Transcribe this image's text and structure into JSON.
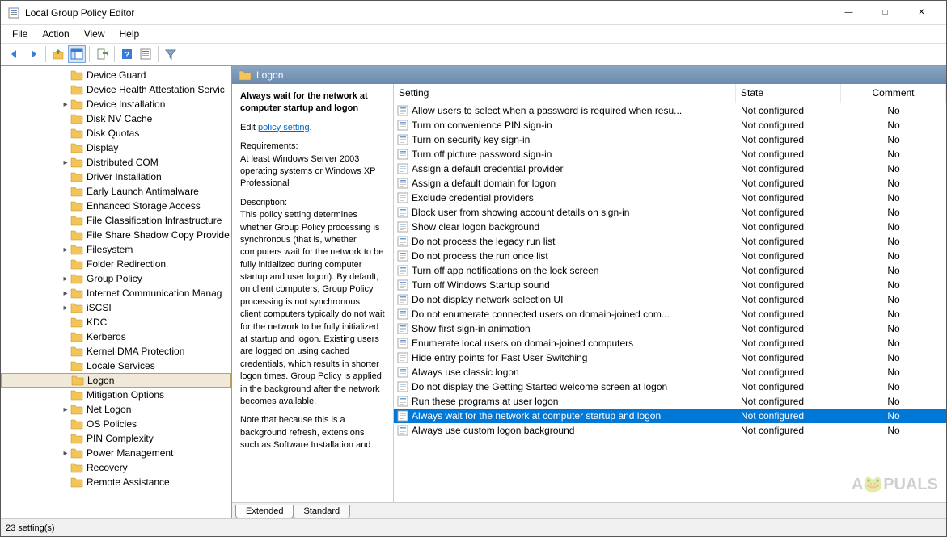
{
  "window": {
    "title": "Local Group Policy Editor"
  },
  "menu": {
    "items": [
      "File",
      "Action",
      "View",
      "Help"
    ]
  },
  "tree": {
    "items": [
      {
        "indent": 72,
        "label": "Device Guard",
        "expand": ""
      },
      {
        "indent": 72,
        "label": "Device Health Attestation Servic",
        "expand": ""
      },
      {
        "indent": 72,
        "label": "Device Installation",
        "expand": ">"
      },
      {
        "indent": 72,
        "label": "Disk NV Cache",
        "expand": ""
      },
      {
        "indent": 72,
        "label": "Disk Quotas",
        "expand": ""
      },
      {
        "indent": 72,
        "label": "Display",
        "expand": ""
      },
      {
        "indent": 72,
        "label": "Distributed COM",
        "expand": ">"
      },
      {
        "indent": 72,
        "label": "Driver Installation",
        "expand": ""
      },
      {
        "indent": 72,
        "label": "Early Launch Antimalware",
        "expand": ""
      },
      {
        "indent": 72,
        "label": "Enhanced Storage Access",
        "expand": ""
      },
      {
        "indent": 72,
        "label": "File Classification Infrastructure",
        "expand": ""
      },
      {
        "indent": 72,
        "label": "File Share Shadow Copy Provide",
        "expand": ""
      },
      {
        "indent": 72,
        "label": "Filesystem",
        "expand": ">"
      },
      {
        "indent": 72,
        "label": "Folder Redirection",
        "expand": ""
      },
      {
        "indent": 72,
        "label": "Group Policy",
        "expand": ">"
      },
      {
        "indent": 72,
        "label": "Internet Communication Manag",
        "expand": ">"
      },
      {
        "indent": 72,
        "label": "iSCSI",
        "expand": ">"
      },
      {
        "indent": 72,
        "label": "KDC",
        "expand": ""
      },
      {
        "indent": 72,
        "label": "Kerberos",
        "expand": ""
      },
      {
        "indent": 72,
        "label": "Kernel DMA Protection",
        "expand": ""
      },
      {
        "indent": 72,
        "label": "Locale Services",
        "expand": ""
      },
      {
        "indent": 72,
        "label": "Logon",
        "expand": "",
        "selected": true
      },
      {
        "indent": 72,
        "label": "Mitigation Options",
        "expand": ""
      },
      {
        "indent": 72,
        "label": "Net Logon",
        "expand": ">"
      },
      {
        "indent": 72,
        "label": "OS Policies",
        "expand": ""
      },
      {
        "indent": 72,
        "label": "PIN Complexity",
        "expand": ""
      },
      {
        "indent": 72,
        "label": "Power Management",
        "expand": ">"
      },
      {
        "indent": 72,
        "label": "Recovery",
        "expand": ""
      },
      {
        "indent": 72,
        "label": "Remote Assistance",
        "expand": ""
      }
    ]
  },
  "content": {
    "header_folder": "Logon",
    "desc_title": "Always wait for the network at computer startup and logon",
    "edit_prefix": "Edit ",
    "edit_link": "policy setting",
    "req_heading": "Requirements:",
    "req_text": "At least Windows Server 2003 operating systems or Windows XP Professional",
    "desc_heading": "Description:",
    "desc_text": "This policy setting determines whether Group Policy processing is synchronous (that is, whether computers wait for the network to be fully initialized during computer startup and user logon). By default, on client computers, Group Policy processing is not synchronous; client computers typically do not wait for the network to be fully initialized at startup and logon. Existing users are logged on using cached credentials, which results in shorter logon times. Group Policy is applied in the background after the network becomes available.",
    "desc_note": "Note that because this is a background refresh, extensions such as Software Installation and",
    "columns": {
      "setting": "Setting",
      "state": "State",
      "comment": "Comment"
    },
    "settings": [
      {
        "name": "Allow users to select when a password is required when resu...",
        "state": "Not configured",
        "comment": "No"
      },
      {
        "name": "Turn on convenience PIN sign-in",
        "state": "Not configured",
        "comment": "No"
      },
      {
        "name": "Turn on security key sign-in",
        "state": "Not configured",
        "comment": "No"
      },
      {
        "name": "Turn off picture password sign-in",
        "state": "Not configured",
        "comment": "No"
      },
      {
        "name": "Assign a default credential provider",
        "state": "Not configured",
        "comment": "No"
      },
      {
        "name": "Assign a default domain for logon",
        "state": "Not configured",
        "comment": "No"
      },
      {
        "name": "Exclude credential providers",
        "state": "Not configured",
        "comment": "No"
      },
      {
        "name": "Block user from showing account details on sign-in",
        "state": "Not configured",
        "comment": "No"
      },
      {
        "name": "Show clear logon background",
        "state": "Not configured",
        "comment": "No"
      },
      {
        "name": "Do not process the legacy run list",
        "state": "Not configured",
        "comment": "No"
      },
      {
        "name": "Do not process the run once list",
        "state": "Not configured",
        "comment": "No"
      },
      {
        "name": "Turn off app notifications on the lock screen",
        "state": "Not configured",
        "comment": "No"
      },
      {
        "name": "Turn off Windows Startup sound",
        "state": "Not configured",
        "comment": "No"
      },
      {
        "name": "Do not display network selection UI",
        "state": "Not configured",
        "comment": "No"
      },
      {
        "name": "Do not enumerate connected users on domain-joined com...",
        "state": "Not configured",
        "comment": "No"
      },
      {
        "name": "Show first sign-in animation",
        "state": "Not configured",
        "comment": "No"
      },
      {
        "name": "Enumerate local users on domain-joined computers",
        "state": "Not configured",
        "comment": "No"
      },
      {
        "name": "Hide entry points for Fast User Switching",
        "state": "Not configured",
        "comment": "No"
      },
      {
        "name": "Always use classic logon",
        "state": "Not configured",
        "comment": "No"
      },
      {
        "name": "Do not display the Getting Started welcome screen at logon",
        "state": "Not configured",
        "comment": "No"
      },
      {
        "name": "Run these programs at user logon",
        "state": "Not configured",
        "comment": "No"
      },
      {
        "name": "Always wait for the network at computer startup and logon",
        "state": "Not configured",
        "comment": "No",
        "selected": true
      },
      {
        "name": "Always use custom logon background",
        "state": "Not configured",
        "comment": "No"
      }
    ]
  },
  "tabs": {
    "extended": "Extended",
    "standard": "Standard"
  },
  "statusbar": {
    "text": "23 setting(s)"
  },
  "watermark": "A🐸PUALS"
}
